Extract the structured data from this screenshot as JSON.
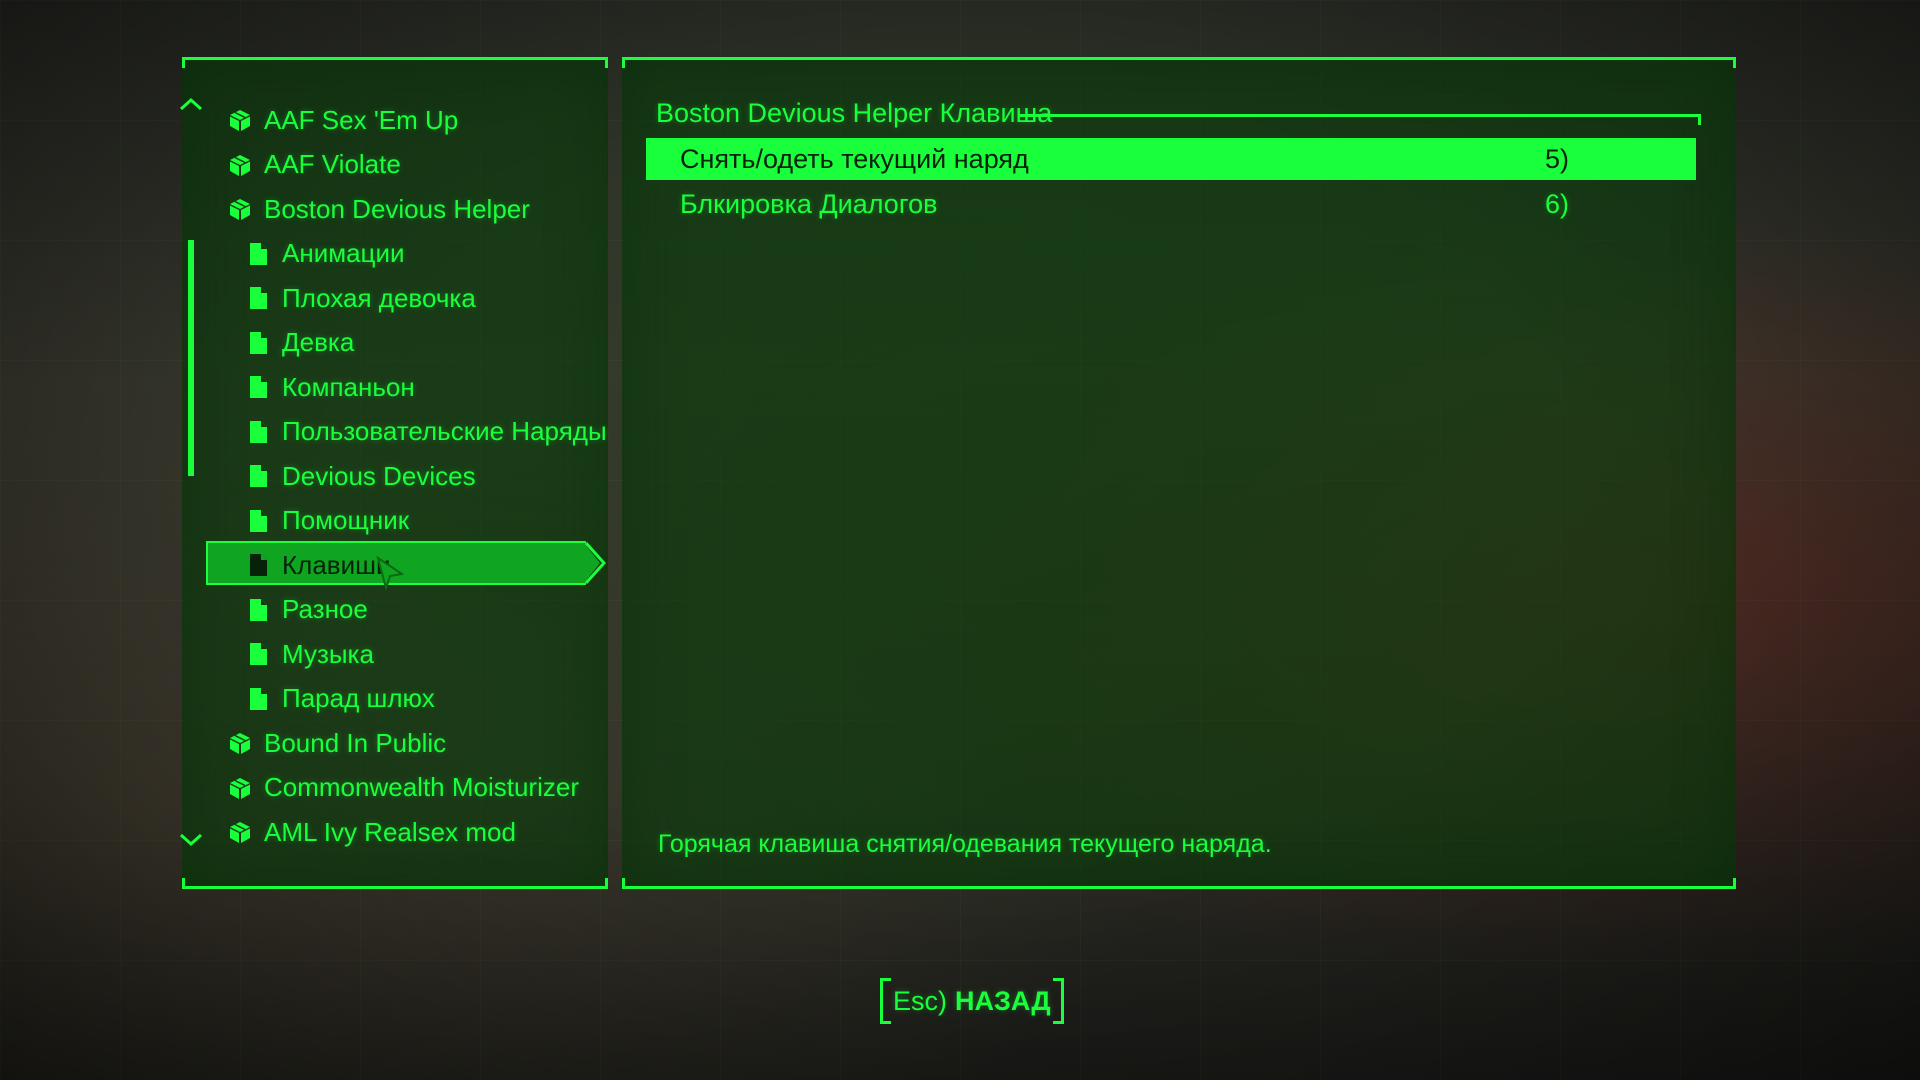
{
  "theme": {
    "accent": "#1aff3c",
    "panel_bg": "#0a3c0c",
    "selected_bg": "#10a520"
  },
  "mod_list": {
    "items": [
      {
        "label": "AAF Sex 'Em Up",
        "type": "mod",
        "icon": "package-icon"
      },
      {
        "label": "AAF Violate",
        "type": "mod",
        "icon": "package-icon"
      },
      {
        "label": "Boston Devious Helper",
        "type": "mod",
        "icon": "package-icon"
      },
      {
        "label": "Анимации",
        "type": "page",
        "icon": "page-icon"
      },
      {
        "label": "Плохая девочка",
        "type": "page",
        "icon": "page-icon"
      },
      {
        "label": "Девка",
        "type": "page",
        "icon": "page-icon"
      },
      {
        "label": "Компаньон",
        "type": "page",
        "icon": "page-icon"
      },
      {
        "label": "Пользовательские Наряды",
        "type": "page",
        "icon": "page-icon"
      },
      {
        "label": "Devious Devices",
        "type": "page",
        "icon": "page-icon"
      },
      {
        "label": "Помощник",
        "type": "page",
        "icon": "page-icon"
      },
      {
        "label": "Клавиши",
        "type": "page",
        "icon": "page-icon",
        "selected": true
      },
      {
        "label": "Разное",
        "type": "page",
        "icon": "page-icon"
      },
      {
        "label": "Музыка",
        "type": "page",
        "icon": "page-icon"
      },
      {
        "label": "Парад шлюх",
        "type": "page",
        "icon": "page-icon"
      },
      {
        "label": "Bound In Public",
        "type": "mod",
        "icon": "package-icon"
      },
      {
        "label": "Commonwealth Moisturizer",
        "type": "mod",
        "icon": "package-icon"
      },
      {
        "label": "AML Ivy Realsex mod",
        "type": "mod",
        "icon": "package-icon"
      }
    ]
  },
  "settings": {
    "header": "Boston Devious Helper Клавиша",
    "rows": [
      {
        "label": "Снять/одеть текущий наряд",
        "value": "5)"
      },
      {
        "label": "Блкировка Диалогов",
        "value": "6)"
      }
    ],
    "description": "Горячая клавиша снятия/одевания текущего наряда."
  },
  "footer": {
    "back_key": "Esc)",
    "back_label": "НАЗАД"
  }
}
